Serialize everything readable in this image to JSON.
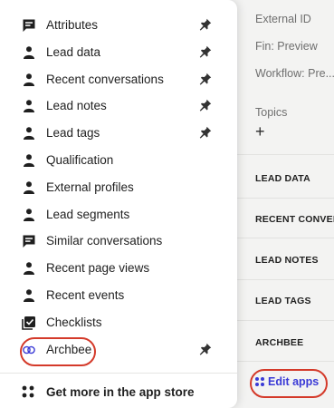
{
  "right_panel": {
    "fields": [
      "External ID",
      "Fin: Preview",
      "Workflow: Pre..."
    ],
    "topics_label": "Topics",
    "add_symbol": "+",
    "sections": [
      "LEAD DATA",
      "RECENT CONVEF",
      "LEAD NOTES",
      "LEAD TAGS",
      "ARCHBEE"
    ],
    "edit_apps_label": "Edit apps",
    "accent_color": "#3a3ad6"
  },
  "menu": {
    "items": [
      {
        "label": "Attributes",
        "icon": "chat-square-icon",
        "pinned": true
      },
      {
        "label": "Lead data",
        "icon": "person-icon",
        "pinned": true
      },
      {
        "label": "Recent conversations",
        "icon": "person-icon",
        "pinned": true
      },
      {
        "label": "Lead notes",
        "icon": "person-icon",
        "pinned": true
      },
      {
        "label": "Lead tags",
        "icon": "person-icon",
        "pinned": true
      },
      {
        "label": "Qualification",
        "icon": "person-icon",
        "pinned": false
      },
      {
        "label": "External profiles",
        "icon": "person-icon",
        "pinned": false
      },
      {
        "label": "Lead segments",
        "icon": "person-icon",
        "pinned": false
      },
      {
        "label": "Similar conversations",
        "icon": "chat-square-icon",
        "pinned": false
      },
      {
        "label": "Recent page views",
        "icon": "person-icon",
        "pinned": false
      },
      {
        "label": "Recent events",
        "icon": "person-icon",
        "pinned": false
      },
      {
        "label": "Checklists",
        "icon": "checklist-icon",
        "pinned": false
      },
      {
        "label": "Archbee",
        "icon": "link-icon",
        "pinned": true
      }
    ],
    "footer_label": "Get more in the app store",
    "highlight_color": "#d43a2a"
  }
}
